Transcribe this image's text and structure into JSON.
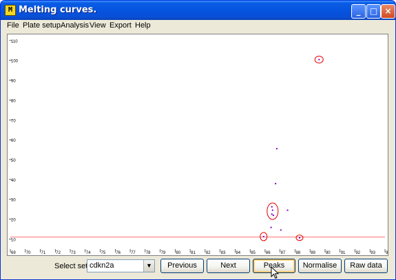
{
  "window": {
    "title": "Melting curves.",
    "icon": "app-chart-icon"
  },
  "title_buttons": {
    "minimize": "_",
    "maximize": "□",
    "close": "×"
  },
  "menu": [
    "File",
    "Plate setup",
    "Analysis",
    "View",
    "Export",
    "Help"
  ],
  "chart_data": {
    "type": "scatter",
    "y_ticks": [
      "110",
      "100",
      "90",
      "80",
      "70",
      "60",
      "50",
      "40",
      "30",
      "20",
      "10"
    ],
    "x_ticks": [
      "69",
      "70",
      "71",
      "72",
      "73",
      "74",
      "75",
      "76",
      "77",
      "78",
      "79",
      "80",
      "81",
      "82",
      "83",
      "84",
      "85",
      "86",
      "87",
      "88",
      "89",
      "90",
      "91",
      "92",
      "93",
      "94"
    ],
    "xlim": [
      69,
      94
    ],
    "ylim": [
      7,
      111
    ],
    "threshold": 11,
    "threshold_color": "#ff6060",
    "series": [
      {
        "color": "#8000c0",
        "points": [
          [
            86.78,
            55.5
          ],
          [
            86.7,
            37.9
          ],
          [
            86.45,
            22.5
          ],
          [
            86.5,
            24.5
          ],
          [
            86.45,
            26.2
          ],
          [
            86.55,
            21.9
          ],
          [
            87.5,
            24.5
          ],
          [
            86.4,
            15.8
          ],
          [
            87.05,
            14.5
          ],
          [
            85.9,
            11.2
          ],
          [
            88.3,
            10.6
          ],
          [
            89.6,
            100.4
          ]
        ]
      }
    ],
    "peak_markers": [
      {
        "x": 89.6,
        "y": 100.4,
        "rx": 6,
        "ry": 5
      },
      {
        "x": 86.5,
        "y": 24,
        "rx": 8,
        "ry": 12
      },
      {
        "x": 85.9,
        "y": 11.2,
        "rx": 5,
        "ry": 6
      },
      {
        "x": 88.3,
        "y": 10.6,
        "rx": 5,
        "ry": 4
      }
    ],
    "peak_marker_color": "#e00000"
  },
  "bottom": {
    "select_set_label": "Select set",
    "selected_set": "cdkn2a",
    "buttons": [
      "Previous",
      "Next",
      "Peaks",
      "Normalise",
      "Raw data"
    ]
  }
}
